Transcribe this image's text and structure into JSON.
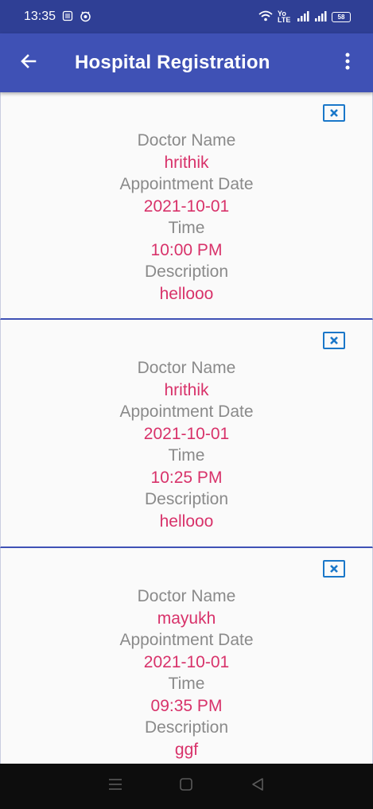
{
  "status_bar": {
    "time": "13:35",
    "battery": "58",
    "left_icons": [
      "sim-card-icon",
      "notification-icon"
    ],
    "right_icons": [
      "wifi-icon",
      "volte-icon",
      "signal-icon",
      "signal-icon-2",
      "battery-icon"
    ],
    "volte_text": "Yo LTE"
  },
  "app_bar": {
    "title": "Hospital Registration",
    "back_icon": "arrow-left-icon",
    "menu_icon": "more-vert-icon"
  },
  "labels": {
    "doctor_name": "Doctor Name",
    "appointment_date": "Appointment Date",
    "time": "Time",
    "description": "Description",
    "close_icon": "close-box-icon"
  },
  "appointments": [
    {
      "doctor_name": "hrithik",
      "date": "2021-10-01",
      "time": "10:00 PM",
      "description": "hellooo"
    },
    {
      "doctor_name": "hrithik",
      "date": "2021-10-01",
      "time": "10:25 PM",
      "description": "hellooo"
    },
    {
      "doctor_name": "mayukh",
      "date": "2021-10-01",
      "time": "09:35 PM",
      "description": "ggf"
    }
  ],
  "nav_bar": {
    "buttons": [
      "menu-nav-icon",
      "home-nav-icon",
      "back-nav-icon"
    ]
  },
  "colors": {
    "status_bar": "#2f3f95",
    "app_bar": "#3f51b5",
    "label": "#8a8a8a",
    "value": "#d8326a",
    "close_icon": "#1a77c9"
  }
}
